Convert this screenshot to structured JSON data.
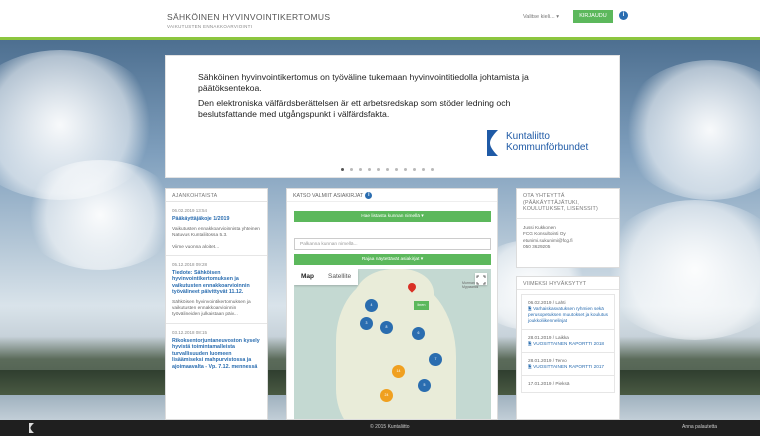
{
  "header": {
    "title": "SÄHKÖINEN HYVINVOINTIKERTOMUS",
    "subtitle": "VAIKUTUSTEN ENNAKKOARVIOINTI",
    "language": "Valitse kieli...",
    "login_label": "KIRJAUDU",
    "info_label": "i"
  },
  "carousel": {
    "text_fi": "Sähköinen hyvinvointikertomus on työväline tukemaan hyvinvointitiedolla johtamista ja päätöksentekoa.",
    "text_sv": "Den elektroniska välfärdsberättelsen är ett arbetsredskap som stöder ledning och beslutsfattande med utgångspunkt i välfärdsfakta.",
    "logo_line1": "Kuntaliitto",
    "logo_line2": "Kommunförbundet",
    "slide_count": 11,
    "active_slide": 0
  },
  "news": {
    "heading": "AJANKOHTAISTA",
    "items": [
      {
        "date": "06.02.2019 13:54",
        "title": "Pääkäyttäjäkoje 1/2019",
        "body": "Vaikutusten ennakkoarvioinnista yhteinen Natuvus Kuntaliitossa 5.3.",
        "more": "Viime vuonna aloitet..."
      },
      {
        "date": "05.12.2018 09:28",
        "title": "Tiedote: Sähköisen hyvinvointikertomuksen ja vaikutusten ennakkoarvioinnin työvälineet päivittyvät 11.12.",
        "body": "Sähköisen hyvinvointikertomuksen ja vaikutusten ennakkoarvioinnin työvälineiden julkaistaan päiv..."
      },
      {
        "date": "03.12.2018 08:15",
        "title": "Rikoksentorjuntaneuvoston kysely hyvistä toimintamalleista turvallisuuden luomeen lisäämiseksi mahpurvistossa ja ajoimaavalta - Vp. 7.12. mennessä"
      }
    ]
  },
  "docs": {
    "heading": "KATSO VALMIIT ASIAKIRJAT",
    "select_button": "Hae listasta kunnan nimellä ▾",
    "search_placeholder": "Palkanna kunnan nimellä...",
    "filter_button": "Rajaa näytettävät asiakirjat ▾",
    "map_tabs": [
      "Map",
      "Satellite"
    ],
    "map_city": "Murmansk Мурманск",
    "map_badge": "linen",
    "markers": [
      {
        "label": "4",
        "kind": "blue"
      },
      {
        "label": "8",
        "kind": "blue"
      },
      {
        "label": "3",
        "kind": "blue"
      },
      {
        "label": "6",
        "kind": "blue"
      },
      {
        "label": "14",
        "kind": "orange"
      },
      {
        "label": "7",
        "kind": "blue"
      },
      {
        "label": "24",
        "kind": "orange"
      },
      {
        "label": "5",
        "kind": "blue"
      }
    ]
  },
  "contact": {
    "heading": "OTA YHTEYTTÄ (PÄÄKÄYTTÄJÄTUKI, KOULUTUKSET, LISENSSIT)",
    "name": "Jussi Kukkonen",
    "company": "FCG Konsultointi Oy",
    "email": "etunimi.sukunimi@fcg.fi",
    "phone": "050 3629205"
  },
  "approved": {
    "heading": "VIIMEKSI HYVÄKSYTYT",
    "items": [
      {
        "date": "06.02.2019 / Lahti",
        "title": "Varhaiskasvatuksen ryhmien sekä perusopetuksen muutokset ja koulutus joukkoliikennelinjat"
      },
      {
        "date": "28.01.2019 / Laikka",
        "title": "VUOSITTAINEN RAPORTTI 2018"
      },
      {
        "date": "28.01.2019 / Tervo",
        "title": "VUOSITTAINEN RAPORTTI 2017"
      },
      {
        "date": "17.01.2019 / Pieksä",
        "title": ""
      }
    ]
  },
  "footer": {
    "copyright": "© 2015 Kuntaliitto",
    "feedback": "Anna palautetta"
  },
  "colors": {
    "accent_green": "#5cb85c",
    "header_line": "#8cc63f",
    "link_blue": "#2a6db0",
    "footer_bg": "#1f1f1f"
  }
}
